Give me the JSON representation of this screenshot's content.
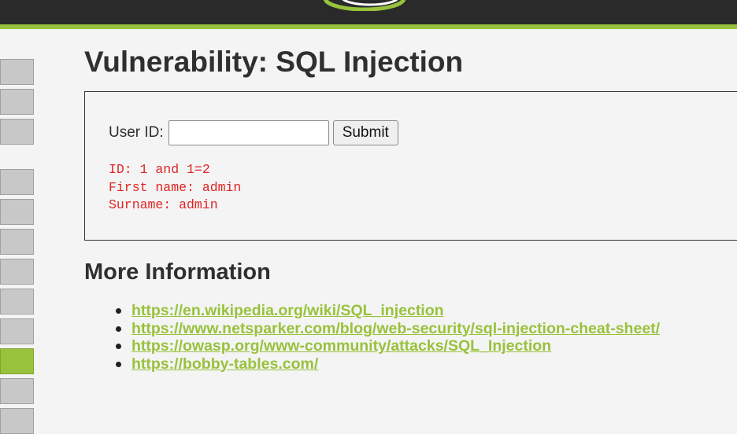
{
  "page": {
    "title": "Vulnerability: SQL Injection"
  },
  "form": {
    "user_id_label": "User ID:",
    "user_id_value": "",
    "submit_label": "Submit"
  },
  "result": {
    "lines": [
      "ID: 1 and 1=2",
      "First name: admin",
      "Surname: admin"
    ]
  },
  "more_info": {
    "heading": "More Information",
    "links": [
      "https://en.wikipedia.org/wiki/SQL_injection",
      "https://www.netsparker.com/blog/web-security/sql-injection-cheat-sheet/",
      "https://owasp.org/www-community/attacks/SQL_Injection",
      "https://bobby-tables.com/"
    ]
  },
  "nav": {
    "button_count": 12,
    "active_index": 8
  },
  "colors": {
    "accent": "#98c23c",
    "header": "#2a2a2a",
    "result_text": "#e02424",
    "background": "#f4f4f4"
  },
  "icons": {
    "logo": "dvwa-logo-icon",
    "bullet": "bullet-icon"
  }
}
